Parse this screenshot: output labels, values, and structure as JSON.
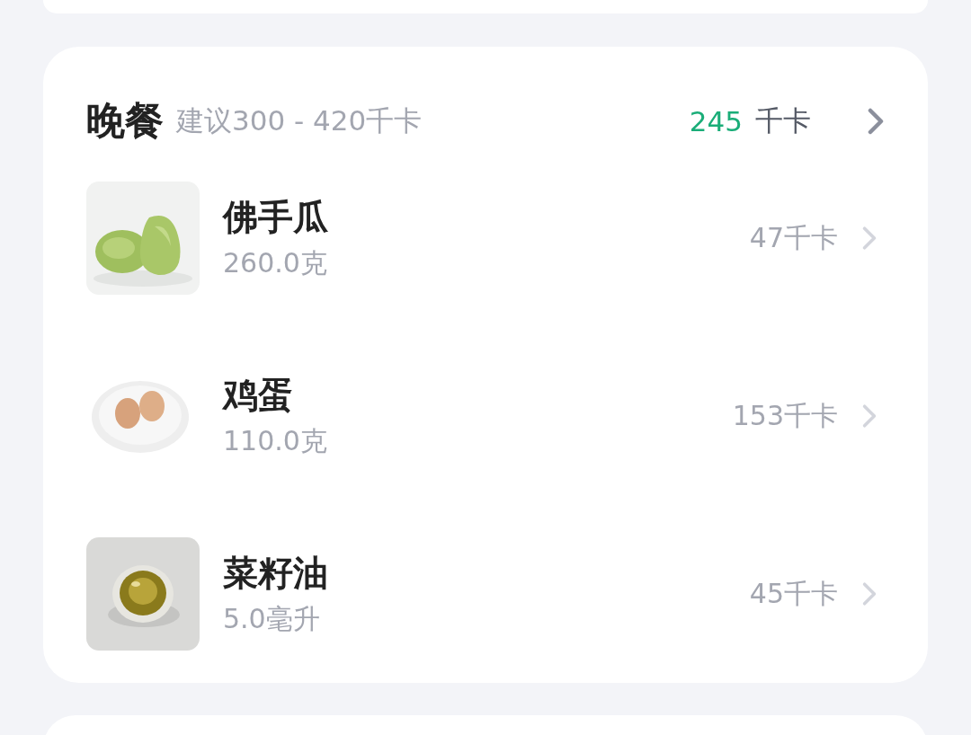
{
  "meal": {
    "title": "晚餐",
    "suggestion": "建议300 - 420千卡",
    "total": "245",
    "total_unit": "千卡"
  },
  "foods": [
    {
      "name": "佛手瓜",
      "amount": "260.0克",
      "calories": "47千卡"
    },
    {
      "name": "鸡蛋",
      "amount": "110.0克",
      "calories": "153千卡"
    },
    {
      "name": "菜籽油",
      "amount": "5.0毫升",
      "calories": "45千卡"
    }
  ]
}
